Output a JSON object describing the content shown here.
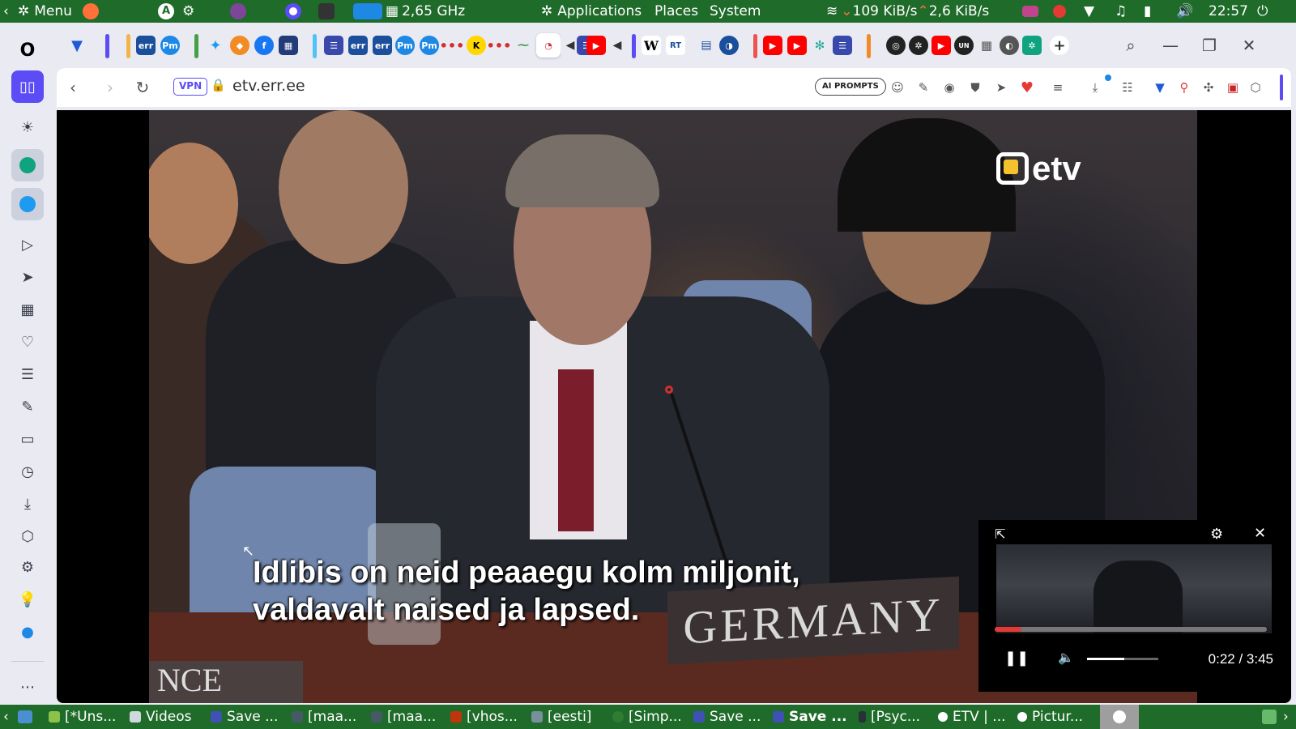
{
  "system_panel": {
    "menu_label": "Menu",
    "cpu_freq": "2,65 GHz",
    "applications_label": "Applications",
    "places_label": "Places",
    "system_label": "System",
    "net_down": "109 KiB/s",
    "net_up": "2,6 KiB/s",
    "clock": "22:57"
  },
  "address_bar": {
    "vpn_badge": "VPN",
    "url": "etv.err.ee",
    "ai_prompts_label": "AI PROMPTS"
  },
  "video": {
    "subtitle_line1": "Idlibis on neid peaaegu kolm miljonit,",
    "subtitle_line2": "valdavalt naised ja lapsed.",
    "nameplate_text": "GERMANY",
    "nameplate_partial": "NCE",
    "channel_logo_text": "etv"
  },
  "pip_player": {
    "time": "0:22 / 3:45",
    "progress_fraction": 0.098,
    "volume_fraction": 0.52,
    "colors": {
      "progress": "#e53935"
    }
  },
  "taskbar": {
    "items": [
      {
        "label": "[*Uns..."
      },
      {
        "label": "Videos"
      },
      {
        "label": "Save ..."
      },
      {
        "label": "[maa..."
      },
      {
        "label": "[maa..."
      },
      {
        "label": "[vhos..."
      },
      {
        "label": "[eesti]"
      },
      {
        "label": "[Simp..."
      },
      {
        "label": "Save ..."
      },
      {
        "label": "Save ..."
      },
      {
        "label": "[Psyc..."
      },
      {
        "label": "ETV | ..."
      },
      {
        "label": "Pictur..."
      }
    ]
  },
  "colors": {
    "panel": "#1f6b2a",
    "accent": "#5b4cf5"
  }
}
